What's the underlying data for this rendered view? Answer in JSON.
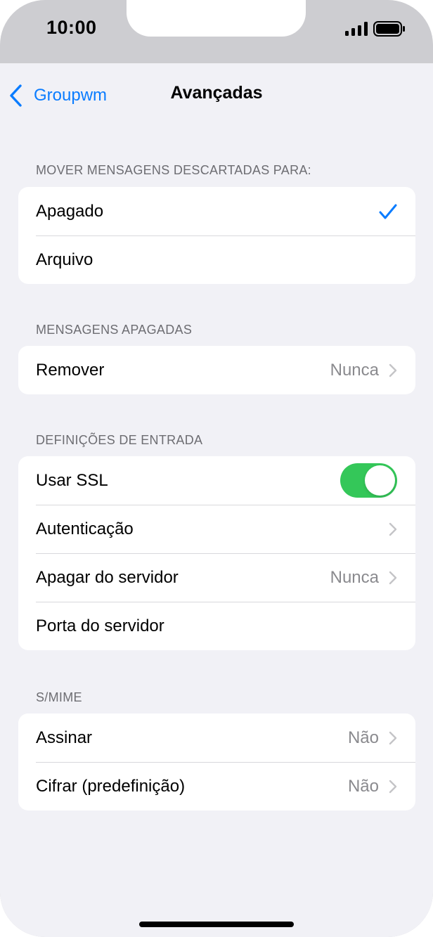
{
  "status_bar": {
    "time": "10:00"
  },
  "nav": {
    "back_label": "Groupwm",
    "title": "Avançadas"
  },
  "sections": [
    {
      "header": "MOVER MENSAGENS DESCARTADAS PARA:",
      "rows": [
        {
          "label": "Apagado",
          "checked": true
        },
        {
          "label": "Arquivo",
          "checked": false
        }
      ]
    },
    {
      "header": "MENSAGENS APAGADAS",
      "rows": [
        {
          "label": "Remover",
          "value": "Nunca"
        }
      ]
    },
    {
      "header": "DEFINIÇÕES DE ENTRADA",
      "rows": [
        {
          "label": "Usar SSL",
          "toggle_on": true
        },
        {
          "label": "Autenticação",
          "value": ""
        },
        {
          "label": "Apagar do servidor",
          "value": "Nunca"
        },
        {
          "label": "Porta do servidor"
        }
      ]
    },
    {
      "header": "S/MIME",
      "rows": [
        {
          "label": "Assinar",
          "value": "Não"
        },
        {
          "label": "Cifrar (predefinição)",
          "value": "Não"
        }
      ]
    }
  ],
  "colors": {
    "accent": "#0a7cff",
    "toggle_on": "#34c759",
    "background": "#f1f1f6"
  },
  "icons": [
    "chevron-left-icon",
    "checkmark-icon",
    "chevron-right-icon",
    "signal-icon",
    "battery-icon"
  ]
}
